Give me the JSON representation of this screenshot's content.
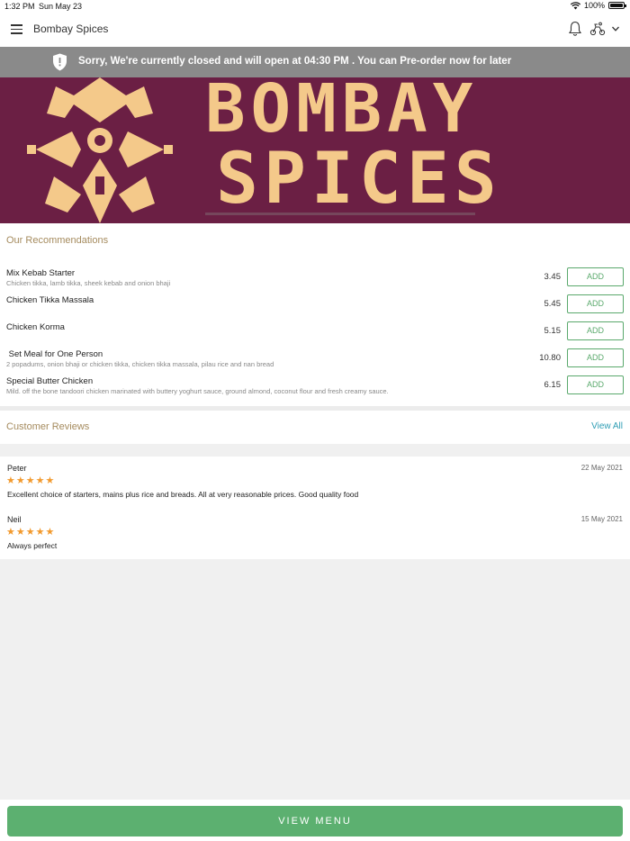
{
  "status_bar": {
    "time": "1:32 PM",
    "date": "Sun May 23",
    "battery": "100%"
  },
  "header": {
    "title": "Bombay Spices"
  },
  "closed_banner": {
    "message": "Sorry, We're currently closed and will open at 04:30 PM . You can Pre-order now for later"
  },
  "hero": {
    "line1": "BOMBAY",
    "line2": "SPICES"
  },
  "recommendations": {
    "title": "Our Recommendations",
    "items": [
      {
        "name": "Mix Kebab Starter",
        "description": "Chicken tikka, lamb tikka, sheek kebab and onion bhaji",
        "price": "3.45",
        "button": "ADD"
      },
      {
        "name": "Chicken Tikka Massala",
        "description": "",
        "price": "5.45",
        "button": "ADD"
      },
      {
        "name": "Chicken Korma",
        "description": "",
        "price": "5.15",
        "button": "ADD"
      },
      {
        "name": " Set Meal for One Person",
        "description": "2 popadums, onion bhaji or chicken tikka, chicken tikka massala, pilau rice and nan bread",
        "price": "10.80",
        "button": "ADD"
      },
      {
        "name": "Special Butter Chicken",
        "description": "Mild. off the bone tandoori chicken marinated with buttery yoghurt sauce, ground almond, coconut flour and fresh creamy sauce.",
        "price": "6.15",
        "button": "ADD"
      }
    ]
  },
  "reviews": {
    "title": "Customer Reviews",
    "view_all": "View All",
    "items": [
      {
        "author": "Peter",
        "date": "22 May 2021",
        "rating": 5,
        "text": "Excellent choice of starters, mains plus rice and breads. All at very reasonable prices. Good quality food"
      },
      {
        "author": "Neil",
        "date": "15 May 2021",
        "rating": 5,
        "text": "Always perfect"
      }
    ]
  },
  "footer": {
    "view_menu": "VIEW MENU"
  },
  "colors": {
    "accent_green": "#5cb070",
    "section_title": "#a58b5e",
    "link_blue": "#2f9db4",
    "star": "#f29a2e",
    "banner_gray": "#8a8a8a",
    "hero_bg": "#6b1f44",
    "hero_text": "#f4c98a"
  },
  "icons": [
    "menu-icon",
    "bell-icon",
    "delivery-icon",
    "chevron-down-icon",
    "shield-icon",
    "wifi-icon",
    "battery-icon",
    "star-icon"
  ]
}
